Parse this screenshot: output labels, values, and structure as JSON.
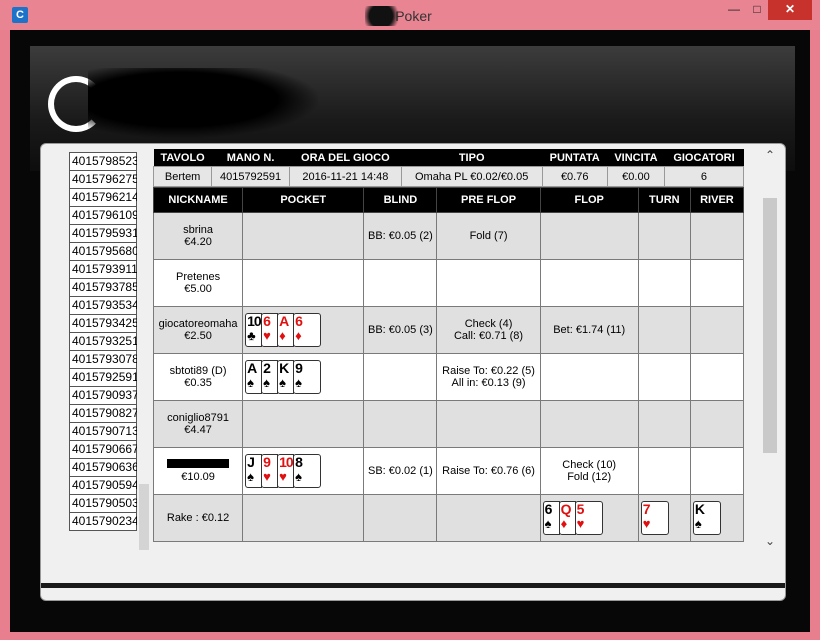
{
  "window": {
    "title": "i Poker",
    "app_icon": "C",
    "minimize": "—",
    "maximize": "□",
    "close": "✕"
  },
  "hand_ids": [
    "4015798523",
    "4015796275",
    "4015796214",
    "4015796109",
    "4015795931",
    "4015795680",
    "4015793911",
    "4015793785",
    "4015793534",
    "4015793425",
    "4015793251",
    "4015793078",
    "4015792591",
    "4015790937",
    "4015790827",
    "4015790713",
    "4015790667",
    "4015790636",
    "4015790594",
    "4015790503",
    "4015790234"
  ],
  "info": {
    "headers": [
      "TAVOLO",
      "MANO N.",
      "ORA DEL GIOCO",
      "TIPO",
      "PUNTATA",
      "VINCITA",
      "GIOCATORI"
    ],
    "values": [
      "Bertem",
      "4015792591",
      "2016-11-21 14:48",
      "Omaha PL €0.02/€0.05",
      "€0.76",
      "€0.00",
      "6"
    ]
  },
  "columns": [
    "NICKNAME",
    "POCKET",
    "BLIND",
    "PRE FLOP",
    "FLOP",
    "TURN",
    "RIVER"
  ],
  "rows": [
    {
      "nick": "sbrina",
      "stack": "€4.20",
      "blind": "BB: €0.05 (2)",
      "preflop": [
        "Fold (7)"
      ],
      "flop": []
    },
    {
      "nick": "Pretenes",
      "stack": "€5.00",
      "blind": "",
      "preflop": [],
      "flop": []
    },
    {
      "nick": "giocatoreomaha",
      "stack": "€2.50",
      "blind": "BB: €0.05 (3)",
      "preflop": [
        "Check (4)",
        "Call: €0.71 (8)"
      ],
      "flop": [
        "Bet: €1.74 (11)"
      ]
    },
    {
      "nick": "sbtoti89 (D)",
      "stack": "€0.35",
      "blind": "",
      "preflop": [
        "Raise To: €0.22 (5)",
        "All in: €0.13 (9)"
      ],
      "flop": []
    },
    {
      "nick": "coniglio8791",
      "stack": "€4.47",
      "blind": "",
      "preflop": [],
      "flop": []
    },
    {
      "nick": "",
      "stack": "€10.09",
      "blind": "SB: €0.02 (1)",
      "preflop": [
        "Raise To: €0.76 (6)"
      ],
      "flop": [
        "Check (10)",
        "Fold (12)"
      ]
    },
    {
      "rake": "Rake : €0.12"
    }
  ],
  "pockets": {
    "giocatoreomaha": [
      {
        "r": "10",
        "s": "♣",
        "c": "blk"
      },
      {
        "r": "6",
        "s": "♥",
        "c": "red"
      },
      {
        "r": "A",
        "s": "♦",
        "c": "red"
      },
      {
        "r": "6",
        "s": "♦",
        "c": "red"
      }
    ],
    "sbtoti89": [
      {
        "r": "A",
        "s": "♠",
        "c": "blk"
      },
      {
        "r": "2",
        "s": "♠",
        "c": "blk"
      },
      {
        "r": "K",
        "s": "♠",
        "c": "blk"
      },
      {
        "r": "9",
        "s": "♠",
        "c": "blk"
      }
    ],
    "hero": [
      {
        "r": "J",
        "s": "♠",
        "c": "blk"
      },
      {
        "r": "9",
        "s": "♥",
        "c": "red"
      },
      {
        "r": "10",
        "s": "♥",
        "c": "red"
      },
      {
        "r": "8",
        "s": "♠",
        "c": "blk"
      }
    ]
  },
  "board": {
    "flop": [
      {
        "r": "6",
        "s": "♠",
        "c": "blk"
      },
      {
        "r": "Q",
        "s": "♦",
        "c": "red"
      },
      {
        "r": "5",
        "s": "♥",
        "c": "red"
      }
    ],
    "turn": [
      {
        "r": "7",
        "s": "♥",
        "c": "red"
      }
    ],
    "river": [
      {
        "r": "K",
        "s": "♠",
        "c": "blk"
      }
    ]
  },
  "icons": {
    "scroll_up": "arrow-up",
    "scroll_down": "arrow-down"
  }
}
